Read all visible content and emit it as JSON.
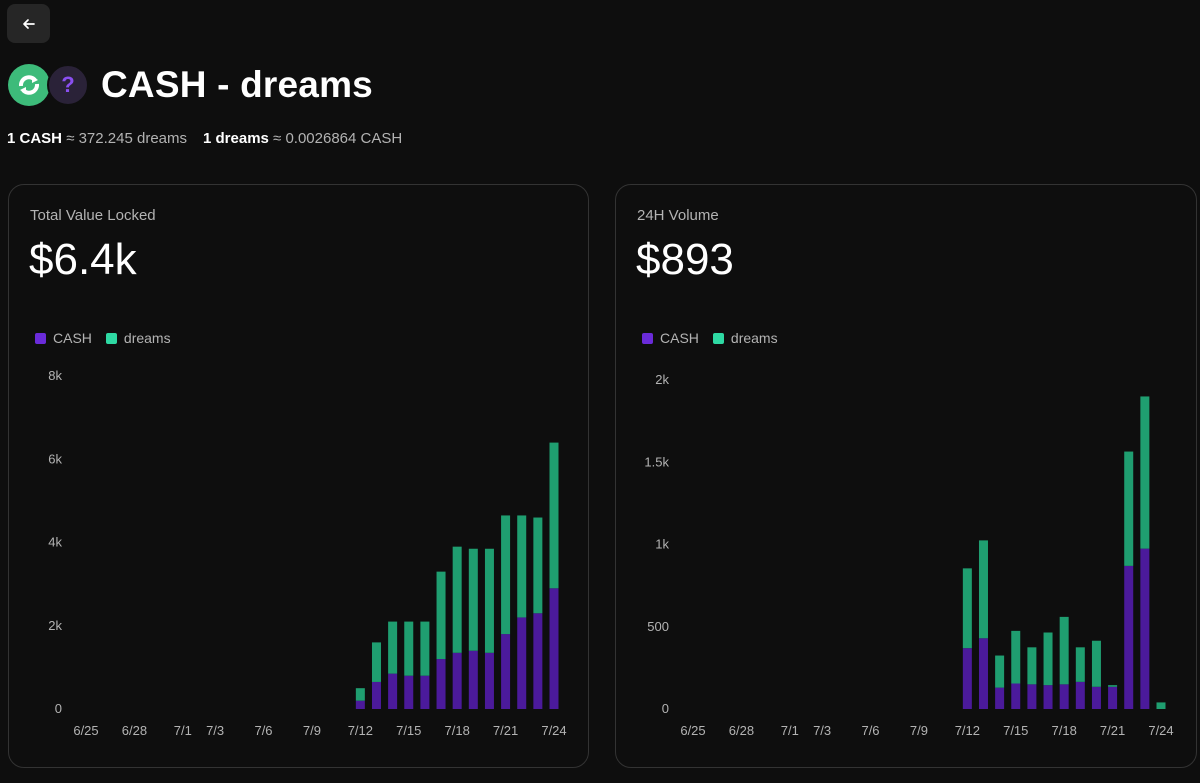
{
  "header": {
    "back_icon": "arrow-left-icon",
    "title": "CASH - dreams",
    "token_a_icon": "refresh-cycle-icon",
    "token_b_icon": "question-mark-icon",
    "token_b_glyph": "?",
    "rate_a_left": "1 CASH",
    "rate_a_right": "≈ 372.245 dreams",
    "rate_b_left": "1 dreams",
    "rate_b_right": "≈ 0.0026864 CASH"
  },
  "colors": {
    "cash": "#4b1a9b",
    "dreams": "#1f9e70",
    "legend_cash": "#6a2bd9",
    "legend_dreams": "#2ed9a3"
  },
  "tvl": {
    "label": "Total Value Locked",
    "value": "$6.4k",
    "legend": [
      "CASH",
      "dreams"
    ]
  },
  "volume": {
    "label": "24H Volume",
    "value": "$893",
    "legend": [
      "CASH",
      "dreams"
    ]
  },
  "chart_data": [
    {
      "type": "bar",
      "stacked": true,
      "title": "Total Value Locked",
      "x": [
        "6/25",
        "6/26",
        "6/27",
        "6/28",
        "6/29",
        "6/30",
        "7/1",
        "7/2",
        "7/3",
        "7/4",
        "7/5",
        "7/6",
        "7/7",
        "7/8",
        "7/9",
        "7/10",
        "7/11",
        "7/12",
        "7/13",
        "7/14",
        "7/15",
        "7/16",
        "7/17",
        "7/18",
        "7/19",
        "7/20",
        "7/21",
        "7/22",
        "7/23",
        "7/24"
      ],
      "x_tick_labels": [
        "6/25",
        "6/28",
        "7/1",
        "7/3",
        "7/6",
        "7/9",
        "7/12",
        "7/15",
        "7/18",
        "7/21",
        "7/24"
      ],
      "series": [
        {
          "name": "CASH",
          "values": [
            0,
            0,
            0,
            0,
            0,
            0,
            0,
            0,
            0,
            0,
            0,
            0,
            0,
            0,
            0,
            0,
            0,
            200,
            650,
            850,
            800,
            800,
            1200,
            1350,
            1400,
            1350,
            1800,
            2200,
            2300,
            2900
          ]
        },
        {
          "name": "dreams",
          "values": [
            0,
            0,
            0,
            0,
            0,
            0,
            0,
            0,
            0,
            0,
            0,
            0,
            0,
            0,
            0,
            0,
            0,
            300,
            950,
            1250,
            1300,
            1300,
            2100,
            2550,
            2450,
            2500,
            2850,
            2450,
            2300,
            3500
          ]
        }
      ],
      "y_ticks": [
        "0",
        "2k",
        "4k",
        "6k",
        "8k"
      ],
      "ylim": [
        0,
        8000
      ],
      "legend_position": "top-left"
    },
    {
      "type": "bar",
      "stacked": true,
      "title": "24H Volume",
      "x": [
        "6/25",
        "6/26",
        "6/27",
        "6/28",
        "6/29",
        "6/30",
        "7/1",
        "7/2",
        "7/3",
        "7/4",
        "7/5",
        "7/6",
        "7/7",
        "7/8",
        "7/9",
        "7/10",
        "7/11",
        "7/12",
        "7/13",
        "7/14",
        "7/15",
        "7/16",
        "7/17",
        "7/18",
        "7/19",
        "7/20",
        "7/21",
        "7/22",
        "7/23",
        "7/24"
      ],
      "x_tick_labels": [
        "6/25",
        "6/28",
        "7/1",
        "7/3",
        "7/6",
        "7/9",
        "7/12",
        "7/15",
        "7/18",
        "7/21",
        "7/24"
      ],
      "series": [
        {
          "name": "CASH",
          "values": [
            0,
            0,
            0,
            0,
            0,
            0,
            0,
            0,
            0,
            0,
            0,
            0,
            0,
            0,
            0,
            0,
            0,
            370,
            430,
            130,
            155,
            150,
            145,
            150,
            165,
            135,
            135,
            870,
            975,
            0
          ]
        },
        {
          "name": "dreams",
          "values": [
            0,
            0,
            0,
            0,
            0,
            0,
            0,
            0,
            0,
            0,
            0,
            0,
            0,
            0,
            0,
            0,
            0,
            485,
            595,
            195,
            320,
            225,
            320,
            410,
            210,
            280,
            10,
            695,
            925,
            40
          ]
        }
      ],
      "y_ticks": [
        "0",
        "500",
        "1k",
        "1.5k",
        "2k"
      ],
      "ylim": [
        0,
        2000
      ],
      "legend_position": "top-left"
    }
  ]
}
